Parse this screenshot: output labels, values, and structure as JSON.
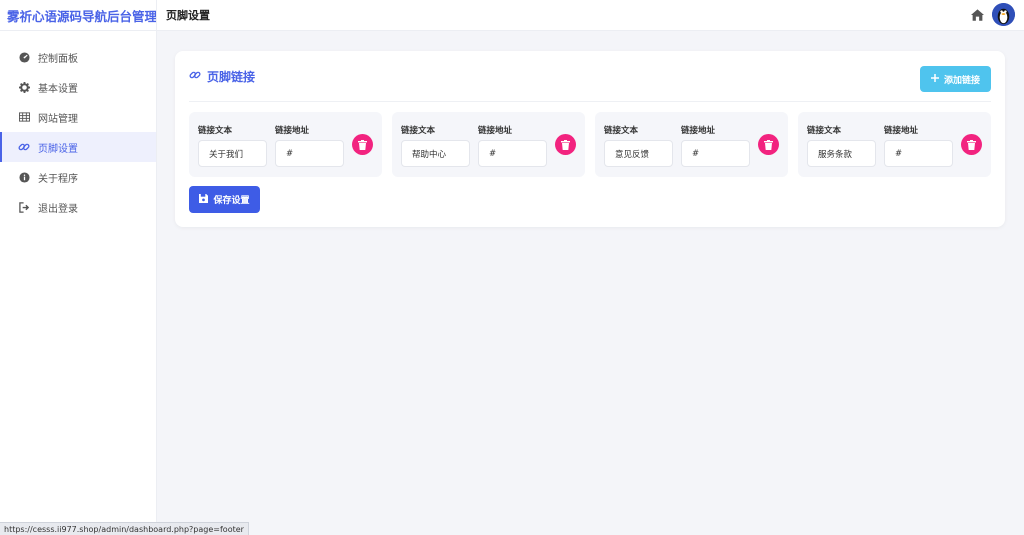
{
  "app": {
    "brand": "雾祈心语源码导航后台管理",
    "page_title": "页脚设置"
  },
  "header": {
    "home_icon": "home-icon",
    "avatar_icon": "penguin-avatar"
  },
  "sidebar": {
    "items": [
      {
        "label": "控制面板",
        "icon": "dashboard-icon"
      },
      {
        "label": "基本设置",
        "icon": "gear-icon"
      },
      {
        "label": "网站管理",
        "icon": "table-icon"
      },
      {
        "label": "页脚设置",
        "icon": "link-icon",
        "active": true
      },
      {
        "label": "关于程序",
        "icon": "info-icon"
      },
      {
        "label": "退出登录",
        "icon": "logout-icon"
      }
    ]
  },
  "card": {
    "title": "页脚链接",
    "add_label": "添加链接",
    "text_label": "链接文本",
    "url_label": "链接地址",
    "links": [
      {
        "text": "关于我们",
        "url": "#"
      },
      {
        "text": "帮助中心",
        "url": "#"
      },
      {
        "text": "意见反馈",
        "url": "#"
      },
      {
        "text": "服务条款",
        "url": "#"
      }
    ],
    "save_label": "保存设置"
  },
  "status_bar": {
    "url": "https://cesss.ii977.shop/admin/dashboard.php?page=footer"
  },
  "colors": {
    "accent": "#4a63e7",
    "add_button": "#4fc4ee",
    "delete": "#f2237f",
    "save": "#3e5ce6"
  }
}
